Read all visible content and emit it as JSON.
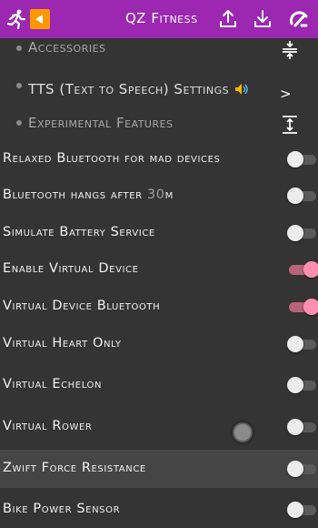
{
  "header": {
    "title": "QZ Fitness",
    "background_color": "#9c27b0",
    "back_button_color": "#ff9800",
    "icons": [
      "runner-icon",
      "back-arrow-icon",
      "share-icon",
      "download-icon",
      "gauge-icon"
    ]
  },
  "sections": [
    {
      "label": "Accessories",
      "icon": "collapse-icon"
    },
    {
      "label": "TTS (Text to Speech) Settings",
      "icon": "chevron-right-icon",
      "chevron": ">"
    },
    {
      "label": "Experimental Features",
      "icon": "expand-icon"
    }
  ],
  "settings": [
    {
      "label": "Relaxed Bluetooth for mad devices",
      "on": false
    },
    {
      "label_prefix": "Bluetooth hangs after ",
      "label_num": "30",
      "label_suffix": "m",
      "on": false
    },
    {
      "label": "Simulate Battery Service",
      "on": false
    },
    {
      "label": "Enable Virtual Device",
      "on": true
    },
    {
      "label": "Virtual Device Bluetooth",
      "on": true
    },
    {
      "label": "Virtual Heart Only",
      "on": false
    },
    {
      "label": "Virtual Echelon",
      "on": false
    },
    {
      "label": "Virtual Rower",
      "on": false
    },
    {
      "label": "Zwift Force Resistance",
      "on": false
    },
    {
      "label": "Bike Power Sensor",
      "on": false
    }
  ],
  "colors": {
    "background": "#343434",
    "switch_on_thumb": "#ff8fb0",
    "switch_on_track": "#b86477",
    "switch_off_thumb": "#ececec",
    "highlight_row": "#454545"
  }
}
